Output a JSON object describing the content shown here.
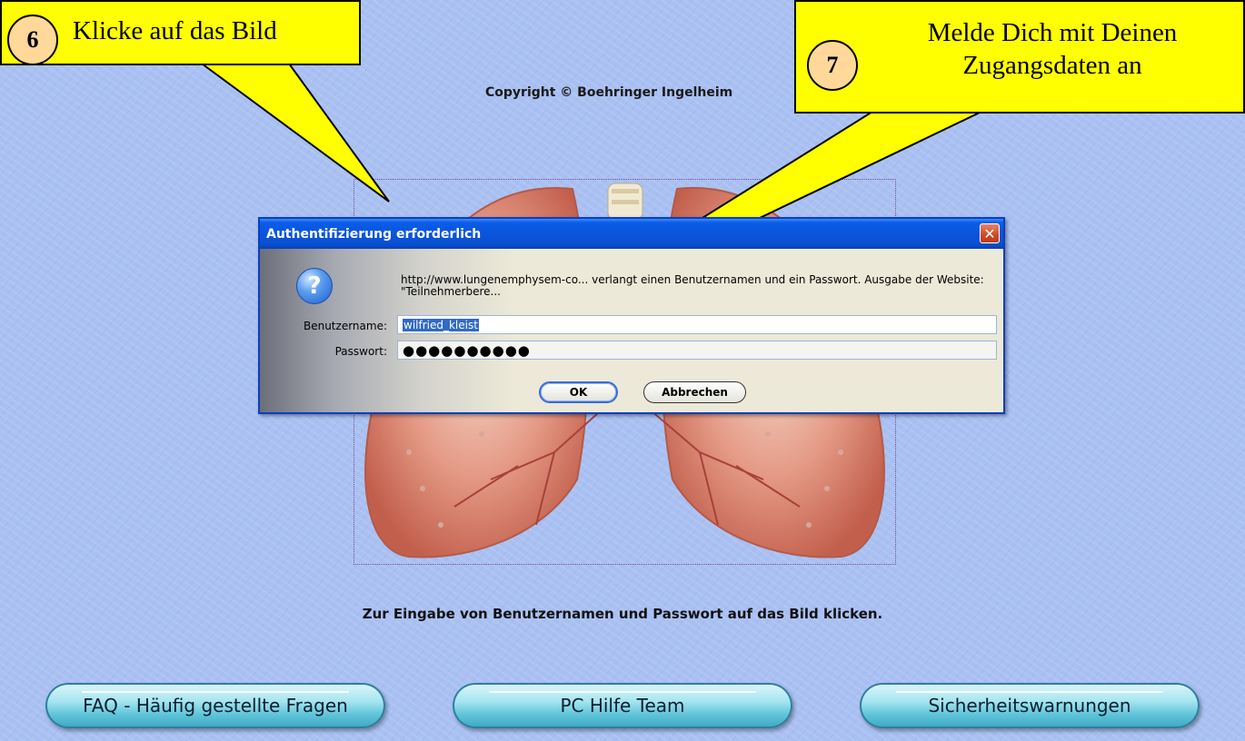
{
  "page": {
    "copyright": "Copyright © Boehringer Ingelheim",
    "instruction": "Zur Eingabe von Benutzernamen und Passwort auf das Bild klicken."
  },
  "nav_buttons": [
    {
      "label": "FAQ - Häufig gestellte Fragen"
    },
    {
      "label": "PC Hilfe Team"
    },
    {
      "label": "Sicherheitswarnungen"
    }
  ],
  "callouts": [
    {
      "number": "6",
      "text": "Klicke auf das Bild"
    },
    {
      "number": "7",
      "text": "Melde Dich mit Deinen Zugangsdaten an"
    }
  ],
  "dialog": {
    "title": "Authentifizierung erforderlich",
    "message": "http://www.lungenemphysem-co... verlangt einen Benutzernamen und ein Passwort. Ausgabe der Website: \"Teilnehmerbere...",
    "username_label": "Benutzername:",
    "username_value": "wilfried_kleist",
    "password_label": "Passwort:",
    "password_value": "●●●●●●●●●●",
    "ok_label": "OK",
    "cancel_label": "Abbrechen",
    "close_symbol": "✕"
  },
  "colors": {
    "background": "#a9c0f2",
    "callout_fill": "#ffff00",
    "titlebar": "#0a55dc",
    "nav_button": "#5fc4d8"
  }
}
